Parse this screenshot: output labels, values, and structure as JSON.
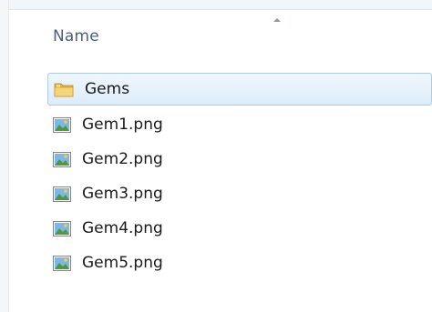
{
  "header": {
    "name_column": "Name"
  },
  "files": [
    {
      "name": "Gems",
      "type": "folder",
      "icon": "folder-icon",
      "selected": true
    },
    {
      "name": "Gem1.png",
      "type": "image",
      "icon": "image-file-icon",
      "selected": false
    },
    {
      "name": "Gem2.png",
      "type": "image",
      "icon": "image-file-icon",
      "selected": false
    },
    {
      "name": "Gem3.png",
      "type": "image",
      "icon": "image-file-icon",
      "selected": false
    },
    {
      "name": "Gem4.png",
      "type": "image",
      "icon": "image-file-icon",
      "selected": false
    },
    {
      "name": "Gem5.png",
      "type": "image",
      "icon": "image-file-icon",
      "selected": false
    }
  ],
  "colors": {
    "selection_border": "#a9cbef",
    "selection_fill": "#dcecfa",
    "header_text": "#4c607a"
  }
}
